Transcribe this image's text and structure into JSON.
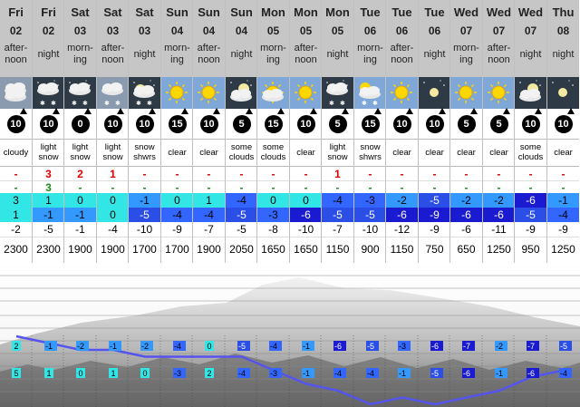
{
  "chart_data": {
    "type": "table",
    "columns": [
      {
        "day": "Fri",
        "date": "02",
        "tod": "after-noon",
        "icon": "cloudy-icon",
        "wind_speed": "10",
        "summary": "cloudy",
        "rain": "-",
        "snow": "-",
        "max_temp": 3,
        "min_temp": 1,
        "chill": -2,
        "freezing_level": 2300
      },
      {
        "day": "Fri",
        "date": "02",
        "tod": "night",
        "icon": "light-snow-night-icon",
        "wind_speed": "10",
        "summary": "light snow",
        "rain": "3",
        "snow": "3",
        "max_temp": 1,
        "min_temp": -1,
        "chill": -5,
        "freezing_level": 2300
      },
      {
        "day": "Sat",
        "date": "03",
        "tod": "morn-ing",
        "icon": "light-snow-night-icon",
        "wind_speed": "0",
        "summary": "light snow",
        "rain": "2",
        "snow": "-",
        "max_temp": 0,
        "min_temp": -1,
        "chill": -1,
        "freezing_level": 1900
      },
      {
        "day": "Sat",
        "date": "03",
        "tod": "after-noon",
        "icon": "light-snow-icon",
        "wind_speed": "10",
        "summary": "light snow",
        "rain": "1",
        "snow": "-",
        "max_temp": 0,
        "min_temp": 0,
        "chill": -4,
        "freezing_level": 1900
      },
      {
        "day": "Sat",
        "date": "03",
        "tod": "night",
        "icon": "snow-showers-night-icon",
        "wind_speed": "10",
        "summary": "snow shwrs",
        "rain": "-",
        "snow": "-",
        "max_temp": -1,
        "min_temp": -5,
        "chill": -10,
        "freezing_level": 1700
      },
      {
        "day": "Sun",
        "date": "04",
        "tod": "morn-ing",
        "icon": "sun-icon",
        "wind_speed": "15",
        "summary": "clear",
        "rain": "-",
        "snow": "-",
        "max_temp": 0,
        "min_temp": -4,
        "chill": -9,
        "freezing_level": 1700
      },
      {
        "day": "Sun",
        "date": "04",
        "tod": "after-noon",
        "icon": "sun-icon",
        "wind_speed": "10",
        "summary": "clear",
        "rain": "-",
        "snow": "-",
        "max_temp": 1,
        "min_temp": -4,
        "chill": -7,
        "freezing_level": 1900
      },
      {
        "day": "Sun",
        "date": "04",
        "tod": "night",
        "icon": "moon-cloud-icon",
        "wind_speed": "5",
        "summary": "some clouds",
        "rain": "-",
        "snow": "-",
        "max_temp": -4,
        "min_temp": -5,
        "chill": -5,
        "freezing_level": 2050
      },
      {
        "day": "Mon",
        "date": "05",
        "tod": "morn-ing",
        "icon": "sun-cloud-icon",
        "wind_speed": "15",
        "summary": "some clouds",
        "rain": "-",
        "snow": "-",
        "max_temp": 0,
        "min_temp": -3,
        "chill": -8,
        "freezing_level": 1650
      },
      {
        "day": "Mon",
        "date": "05",
        "tod": "after-noon",
        "icon": "sun-icon",
        "wind_speed": "10",
        "summary": "clear",
        "rain": "-",
        "snow": "-",
        "max_temp": 0,
        "min_temp": -6,
        "chill": -10,
        "freezing_level": 1650
      },
      {
        "day": "Mon",
        "date": "05",
        "tod": "night",
        "icon": "light-snow-night-icon",
        "wind_speed": "5",
        "summary": "light snow",
        "rain": "1",
        "snow": "-",
        "max_temp": -4,
        "min_temp": -5,
        "chill": -7,
        "freezing_level": 1150
      },
      {
        "day": "Tue",
        "date": "06",
        "tod": "morn-ing",
        "icon": "sun-snow-icon",
        "wind_speed": "15",
        "summary": "snow shwrs",
        "rain": "-",
        "snow": "-",
        "max_temp": -3,
        "min_temp": -5,
        "chill": -10,
        "freezing_level": 900
      },
      {
        "day": "Tue",
        "date": "06",
        "tod": "after-noon",
        "icon": "sun-icon",
        "wind_speed": "10",
        "summary": "clear",
        "rain": "-",
        "snow": "-",
        "max_temp": -2,
        "min_temp": -6,
        "chill": -12,
        "freezing_level": 1150
      },
      {
        "day": "Tue",
        "date": "06",
        "tod": "night",
        "icon": "clear-night-icon",
        "wind_speed": "10",
        "summary": "clear",
        "rain": "-",
        "snow": "-",
        "max_temp": -5,
        "min_temp": -9,
        "chill": -9,
        "freezing_level": 750
      },
      {
        "day": "Wed",
        "date": "07",
        "tod": "morn-ing",
        "icon": "sun-icon",
        "wind_speed": "5",
        "summary": "clear",
        "rain": "-",
        "snow": "-",
        "max_temp": -2,
        "min_temp": -6,
        "chill": -6,
        "freezing_level": 650
      },
      {
        "day": "Wed",
        "date": "07",
        "tod": "after-noon",
        "icon": "sun-icon",
        "wind_speed": "5",
        "summary": "clear",
        "rain": "-",
        "snow": "-",
        "max_temp": -2,
        "min_temp": -6,
        "chill": -11,
        "freezing_level": 1250
      },
      {
        "day": "Wed",
        "date": "07",
        "tod": "night",
        "icon": "moon-cloud-icon",
        "wind_speed": "10",
        "summary": "some clouds",
        "rain": "-",
        "snow": "-",
        "max_temp": -6,
        "min_temp": -5,
        "chill": -9,
        "freezing_level": 950
      },
      {
        "day": "Thu",
        "date": "08",
        "tod": "night",
        "icon": "clear-night-icon",
        "wind_speed": "10",
        "summary": "clear",
        "rain": "-",
        "snow": "-",
        "max_temp": -1,
        "min_temp": -4,
        "chill": -9,
        "freezing_level": 1250
      }
    ],
    "graph": {
      "top_labels": [
        2,
        -1,
        -2,
        -1,
        -2,
        -4,
        0,
        -5,
        -4,
        -1,
        -6,
        -5,
        -3,
        -6,
        -7,
        -2,
        -7,
        -5
      ],
      "bottom_labels": [
        5,
        1,
        0,
        1,
        0,
        -3,
        2,
        -4,
        -3,
        -1,
        -4,
        -4,
        -1,
        -5,
        -6,
        -1,
        -6,
        -4
      ],
      "line": [
        2,
        1,
        0,
        0,
        -1,
        -1,
        -1,
        -1,
        -3,
        -5,
        -6,
        -8,
        -7,
        -8,
        -7,
        -6,
        -4,
        -3
      ]
    },
    "colors": {
      "header_bg": "#c6c6c6",
      "icon_bg": "#2e3a46",
      "temp_scale": {
        "3": "#33e6e6",
        "1": "#33e6e6",
        "0": "#33e6e6",
        "-1": "#3399ff",
        "-2": "#3399ff",
        "-3": "#3366ff",
        "-4": "#3366ff",
        "-5": "#1f3fd9",
        "-6": "#1a1ad0"
      }
    }
  }
}
